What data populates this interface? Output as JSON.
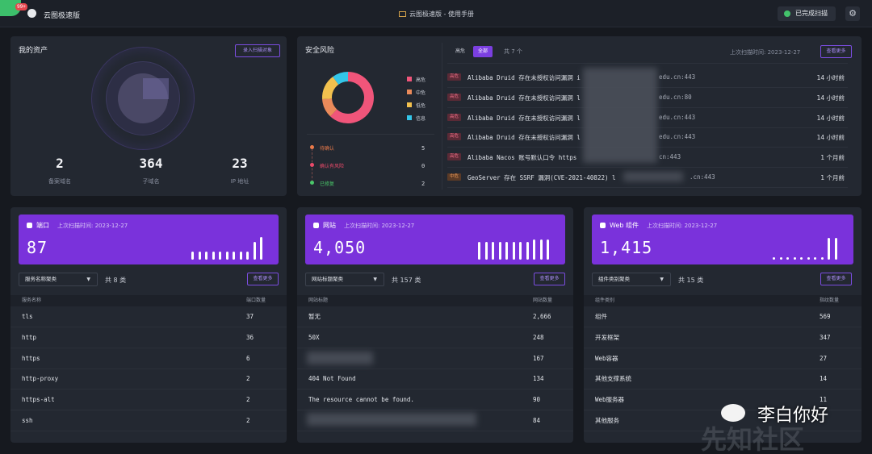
{
  "topbar": {
    "logo_badge": "99+",
    "app_title": "云图极速版",
    "center_title": "云图极速版 - 使用手册",
    "scan_status": "已完成扫描",
    "settings_icon": "gear-icon"
  },
  "assets": {
    "title": "我的资产",
    "import_button": "录入扫描对象",
    "stats": [
      {
        "value": "2",
        "label": "备案域名"
      },
      {
        "value": "364",
        "label": "子域名"
      },
      {
        "value": "23",
        "label": "IP 地址"
      }
    ]
  },
  "risk": {
    "title": "安全风险",
    "donut": [
      {
        "label": "高危",
        "value": 0.62,
        "color": "#f0557a"
      },
      {
        "label": "中危",
        "value": 0.12,
        "color": "#ea8a5a"
      },
      {
        "label": "低危",
        "value": 0.16,
        "color": "#f2c14e"
      },
      {
        "label": "信息",
        "value": 0.1,
        "color": "#34c6e8"
      }
    ],
    "flow": [
      {
        "label": "待确认",
        "count": "5",
        "color": "#ea7a4a"
      },
      {
        "label": "确认有风险",
        "count": "0",
        "color": "#ea4a6a"
      },
      {
        "label": "已修复",
        "count": "2",
        "color": "#4ac76a"
      }
    ],
    "tabs": [
      {
        "label": "高危",
        "active": false
      },
      {
        "label": "全部",
        "active": true
      }
    ],
    "total": "共 7 个",
    "last_scan": "上次扫描时间: 2023-12-27",
    "more_button": "查看更多",
    "rows": [
      {
        "severity": "高危",
        "text": "Alibaba Druid 存在未授权访问漏洞 i",
        "host": "edu.cn:443",
        "time": "14 小时前"
      },
      {
        "severity": "高危",
        "text": "Alibaba Druid 存在未授权访问漏洞 l",
        "host": "edu.cn:80",
        "time": "14 小时前"
      },
      {
        "severity": "高危",
        "text": "Alibaba Druid 存在未授权访问漏洞 l",
        "host": "edu.cn:443",
        "time": "14 小时前"
      },
      {
        "severity": "高危",
        "text": "Alibaba Druid 存在未授权访问漏洞 l",
        "host": "edu.cn:443",
        "time": "14 小时前"
      },
      {
        "severity": "高危",
        "text": "Alibaba Nacos 账号默认口令 https",
        "host": "cn:443",
        "time": "1 个月前"
      },
      {
        "severity": "中危",
        "text": "GeoServer 存在 SSRF 漏洞(CVE-2021-40822) l",
        "host": ".cn:443",
        "time": "1 个月前"
      }
    ]
  },
  "ports": {
    "title": "端口",
    "last_scan": "上次扫描时间: 2023-12-27",
    "count": "87",
    "bars": [
      0.35,
      0.35,
      0.35,
      0.35,
      0.35,
      0.35,
      0.35,
      0.35,
      0.35,
      0.75,
      0.95
    ],
    "select": "服务名称聚类",
    "total": "共 8 类",
    "more_button": "查看更多",
    "col1": "服务名称",
    "col2": "端口数量",
    "rows": [
      {
        "name": "tls",
        "value": "37"
      },
      {
        "name": "http",
        "value": "36"
      },
      {
        "name": "https",
        "value": "6"
      },
      {
        "name": "http-proxy",
        "value": "2"
      },
      {
        "name": "https-alt",
        "value": "2"
      },
      {
        "name": "ssh",
        "value": "2"
      }
    ]
  },
  "sites": {
    "title": "网站",
    "last_scan": "上次扫描时间: 2023-12-27",
    "count": "4,050",
    "bars": [
      0.75,
      0.75,
      0.75,
      0.75,
      0.75,
      0.75,
      0.75,
      0.75,
      0.85,
      0.85,
      0.85
    ],
    "select": "网站标题聚类",
    "total": "共 157 类",
    "more_button": "查看更多",
    "col1": "网站标题",
    "col2": "网站数量",
    "rows": [
      {
        "name": "暂无",
        "value": "2,666"
      },
      {
        "name": "50X",
        "value": "248"
      },
      {
        "name": "",
        "value": "167"
      },
      {
        "name": "404 Not Found",
        "value": "134"
      },
      {
        "name": "The resource cannot be found.",
        "value": "90"
      },
      {
        "name": "",
        "value": "84"
      }
    ]
  },
  "webcomp": {
    "title": "Web 组件",
    "last_scan": "上次扫描时间: 2023-12-27",
    "count": "1,415",
    "bars": [
      0.1,
      0.1,
      0.1,
      0.1,
      0.1,
      0.1,
      0.1,
      0.1,
      0.9,
      0.9
    ],
    "select": "组件类别聚类",
    "total": "共 15 类",
    "more_button": "查看更多",
    "col1": "组件类别",
    "col2": "指纹数量",
    "rows": [
      {
        "name": "组件",
        "value": "569"
      },
      {
        "name": "开发框架",
        "value": "347"
      },
      {
        "name": "Web容器",
        "value": "27"
      },
      {
        "name": "其他支撑系统",
        "value": "14"
      },
      {
        "name": "Web服务器",
        "value": "11"
      },
      {
        "name": "其他服务",
        "value": ""
      }
    ]
  },
  "watermark": {
    "text": "李白你好",
    "bg_text": "先知社区"
  }
}
